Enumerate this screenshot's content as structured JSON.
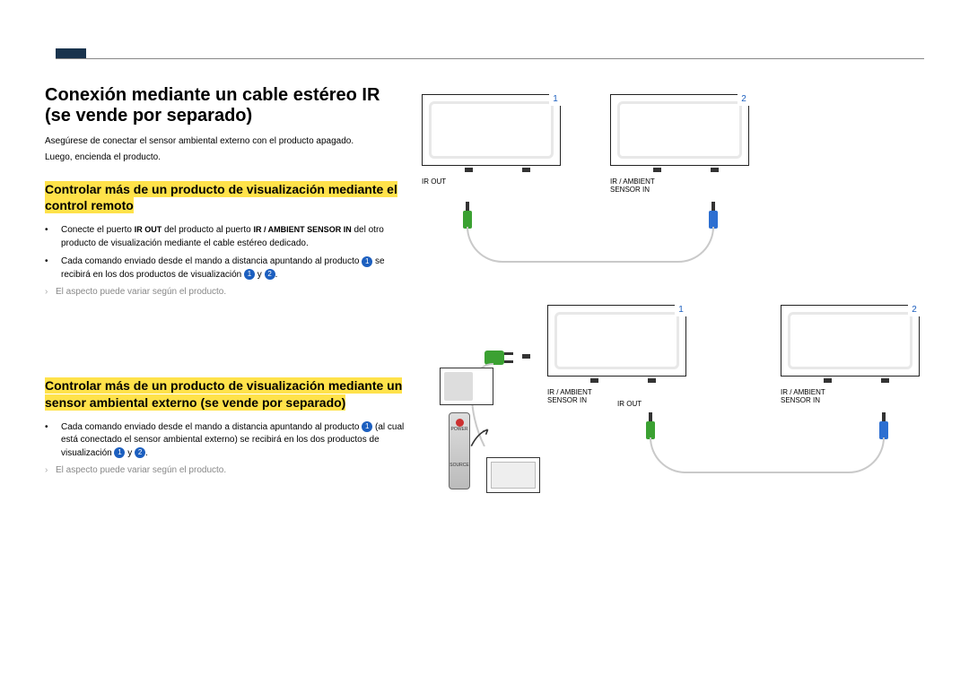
{
  "heading": "Conexión mediante un cable estéreo IR (se vende por separado)",
  "intro1": "Asegúrese de conectar el sensor ambiental externo con el producto apagado.",
  "intro2": "Luego, encienda el producto.",
  "sub1": "Controlar más de un producto de visualización mediante el control remoto",
  "b1_pre": "Conecte el puerto ",
  "b1_port1": "IR OUT",
  "b1_mid": " del producto al puerto ",
  "b1_port2": "IR / AMBIENT SENSOR IN",
  "b1_post": " del otro producto de visualización mediante el cable estéreo dedicado.",
  "b2_pre": "Cada comando enviado desde el mando a distancia apuntando al producto ",
  "b2_mid": " se recibirá en los dos productos de visualización ",
  "b2_y": " y ",
  "b2_end": ".",
  "note": "El aspecto puede variar según el producto.",
  "sub2": "Controlar más de un producto de visualización mediante un sensor ambiental externo (se vende por separado)",
  "b3_pre": "Cada comando enviado desde el mando a distancia apuntando al producto ",
  "b3_mid": " (al cual está conectado el sensor ambiental externo) se recibirá en los dos productos de visualización ",
  "b3_y": " y ",
  "b3_end": ".",
  "num1": "1",
  "num2": "2",
  "lbl_irout": "IR OUT",
  "lbl_irin": "IR / AMBIENT\nSENSOR IN",
  "bullet_marker": "•",
  "remote_power": "POWER",
  "remote_source": "SOURCE"
}
